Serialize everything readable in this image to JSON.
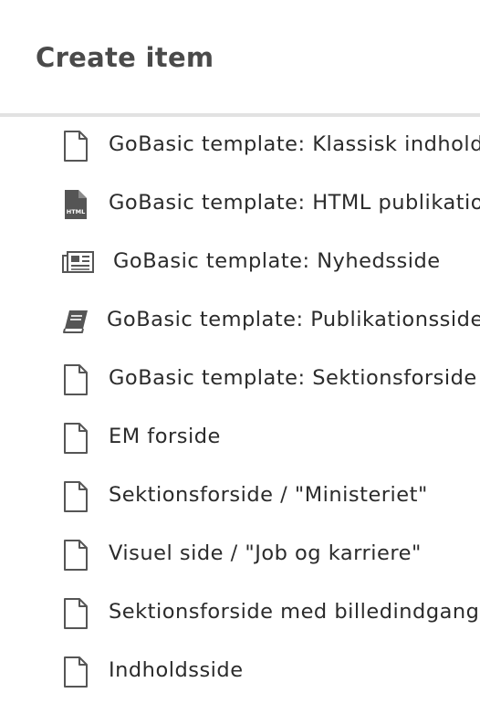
{
  "dialog": {
    "title": "Create item"
  },
  "items": [
    {
      "label": "GoBasic template: Klassisk indholdsside",
      "icon": "document-icon"
    },
    {
      "label": "GoBasic template: HTML publikation",
      "icon": "html-file-icon"
    },
    {
      "label": "GoBasic template: Nyhedsside",
      "icon": "newspaper-icon"
    },
    {
      "label": "GoBasic template: Publikationsside",
      "icon": "book-icon"
    },
    {
      "label": "GoBasic template: Sektionsforside",
      "icon": "document-icon"
    },
    {
      "label": "EM forside",
      "icon": "document-icon"
    },
    {
      "label": "Sektionsforside / \"Ministeriet\"",
      "icon": "document-icon"
    },
    {
      "label": "Visuel side / \"Job og karriere\"",
      "icon": "document-icon"
    },
    {
      "label": "Sektionsforside med billedindgange",
      "icon": "document-icon"
    },
    {
      "label": "Indholdsside",
      "icon": "document-icon"
    }
  ],
  "icon_text": {
    "html": "HTML"
  },
  "colors": {
    "title": "#4a4a4a",
    "text": "#2b2b2b",
    "icon": "#555555",
    "divider": "#e2e2e2"
  }
}
